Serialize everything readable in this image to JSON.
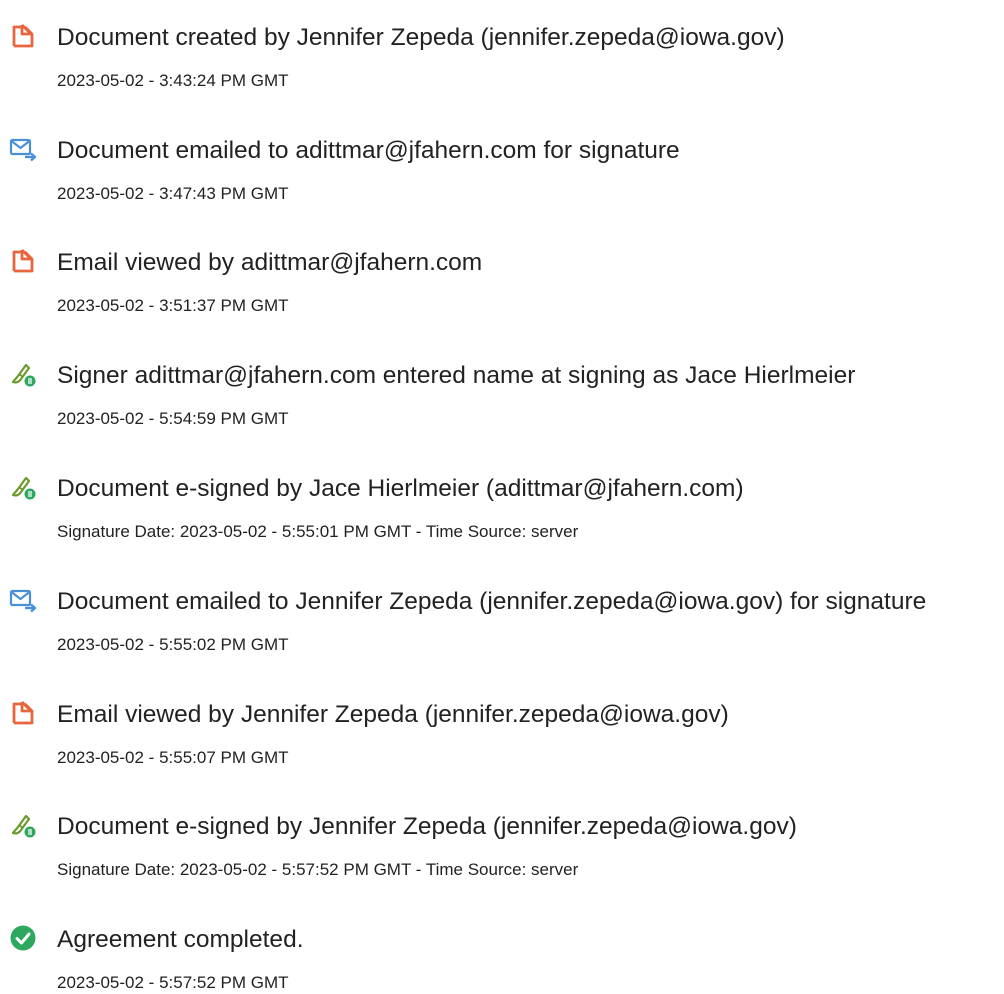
{
  "colors": {
    "doc_icon": "#e8663d",
    "email_icon": "#4a90d9",
    "sign_icon": "#6b9a2e",
    "sign_badge": "#2fa85f",
    "check_icon": "#2fa85f",
    "text": "#222222"
  },
  "events": [
    {
      "icon": "document-icon",
      "title": "Document created by Jennifer Zepeda (jennifer.zepeda@iowa.gov)",
      "time": "2023-05-02 - 3:43:24 PM GMT"
    },
    {
      "icon": "email-send-icon",
      "title": "Document emailed to adittmar@jfahern.com for signature",
      "time": "2023-05-02 - 3:47:43 PM GMT"
    },
    {
      "icon": "document-icon",
      "title": "Email viewed by adittmar@jfahern.com",
      "time": "2023-05-02 - 3:51:37 PM GMT"
    },
    {
      "icon": "esign-pen-icon",
      "title": "Signer adittmar@jfahern.com entered name at signing as Jace Hierlmeier",
      "time": "2023-05-02 - 5:54:59 PM GMT"
    },
    {
      "icon": "esign-pen-icon",
      "title": "Document e-signed by Jace Hierlmeier (adittmar@jfahern.com)",
      "time": "Signature Date: 2023-05-02 - 5:55:01 PM GMT - Time Source: server"
    },
    {
      "icon": "email-send-icon",
      "title": "Document emailed to Jennifer Zepeda (jennifer.zepeda@iowa.gov) for signature",
      "time": "2023-05-02 - 5:55:02 PM GMT"
    },
    {
      "icon": "document-icon",
      "title": "Email viewed by Jennifer Zepeda (jennifer.zepeda@iowa.gov)",
      "time": "2023-05-02 - 5:55:07 PM GMT"
    },
    {
      "icon": "esign-pen-icon",
      "title": "Document e-signed by Jennifer Zepeda (jennifer.zepeda@iowa.gov)",
      "time": "Signature Date: 2023-05-02 - 5:57:52 PM GMT - Time Source: server"
    },
    {
      "icon": "check-circle-icon",
      "title": "Agreement completed.",
      "time": "2023-05-02 - 5:57:52 PM GMT"
    }
  ]
}
